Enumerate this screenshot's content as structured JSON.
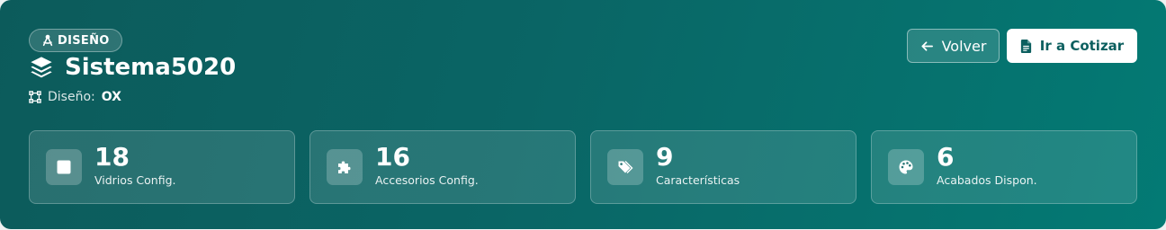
{
  "header": {
    "badge": "DISEÑO",
    "title": "Sistema5020",
    "subtitle_label": "Diseño:",
    "subtitle_value": "OX"
  },
  "actions": {
    "back_label": "Volver",
    "quote_label": "Ir a Cotizar"
  },
  "stats": [
    {
      "value": "18",
      "label": "Vidrios Config.",
      "icon": "square-icon"
    },
    {
      "value": "16",
      "label": "Accesorios Config.",
      "icon": "puzzle-icon"
    },
    {
      "value": "9",
      "label": "Características",
      "icon": "tags-icon"
    },
    {
      "value": "6",
      "label": "Acabados Dispon.",
      "icon": "palette-icon"
    }
  ],
  "colors": {
    "gradient_start": "#0c5b5b",
    "gradient_end": "#037a74",
    "primary_text": "#0c5f5f"
  }
}
